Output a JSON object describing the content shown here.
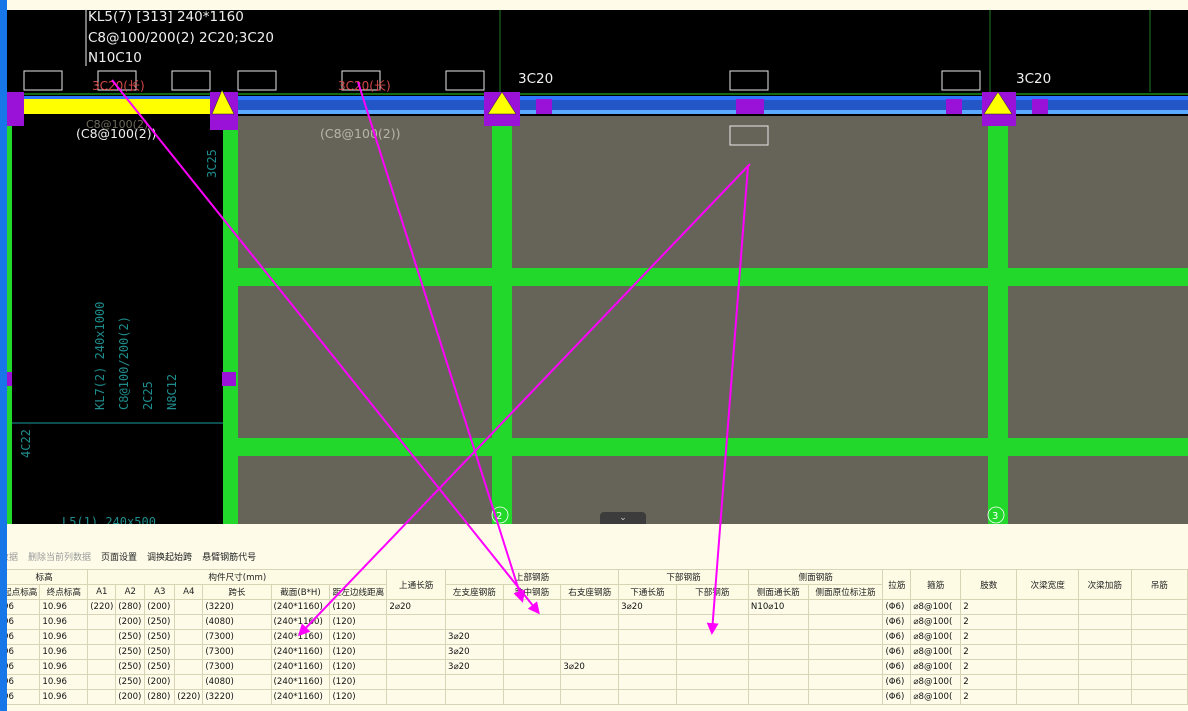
{
  "canvas": {
    "beam_kl5": {
      "line1": "KL5(7) [313] 240*1160",
      "line2": "C8@100/200(2) 2C20;3C20",
      "line3": "N10C10"
    },
    "labels": {
      "top_3c20_a": "3C20",
      "top_3c20_b": "3C20",
      "red_left": "3C20(长)",
      "red_mid": "3C20(长)",
      "stirrup_left": "(C8@100(2))",
      "stirrup_mid": "(C8@100(2))",
      "faded_left": "C8@100(2)",
      "col_3c25": "3C25",
      "kl7_line1": "KL7(2) 240x1000",
      "kl7_line2": "C8@100/200(2)",
      "kl7_line3": "2C25",
      "kl7_line4": "N8C12",
      "left_4c22": "4C22",
      "bottom_left": "L5(1) 240x500",
      "axis_2": "2",
      "axis_3": "3"
    },
    "colors": {
      "background": "#000000",
      "slab": "#666459",
      "green": "#22d82a",
      "yellow": "#ffff00",
      "magenta": "#ff00ff",
      "purple": "#9a11d8",
      "blue": "#2e78ff",
      "red_text": "#e04a4a"
    }
  },
  "toolbar": {
    "items": [
      "数据",
      "删除当前列数据",
      "页面设置",
      "调换起始跨",
      "悬臂钢筋代号"
    ]
  },
  "table": {
    "group_headers": {
      "elevation": "标高",
      "size": "构件尺寸(mm)",
      "top_rebar": "上部钢筋",
      "bottom_rebar": "下部钢筋",
      "side_rebar": "侧面钢筋"
    },
    "columns": {
      "start_elev": "起点标高",
      "end_elev": "终点标高",
      "a1": "A1",
      "a2": "A2",
      "a3": "A3",
      "a4": "A4",
      "span": "跨长",
      "section": "截面(B*H)",
      "offset": "距左边线距离",
      "top_through": "上通长筋",
      "left_support": "左支座钢筋",
      "mid_span": "跨中钢筋",
      "right_support": "右支座钢筋",
      "bottom_through": "下通长筋",
      "bottom_rebar": "下部钢筋",
      "side_through": "侧面通长筋",
      "side_original": "侧面原位标注筋",
      "tie": "拉筋",
      "stirrup": "箍筋",
      "legs": "肢数",
      "sec_beam_width": "次梁宽度",
      "sec_beam_add": "次梁加筋",
      "hanger": "吊筋"
    },
    "rows": [
      {
        "start": "96",
        "end": "10.96",
        "a1": "(220)",
        "a2": "(280)",
        "a3": "(200)",
        "a4": "",
        "span": "(3220)",
        "section": "(240*1160)",
        "offset": "(120)",
        "top": "2⌀20",
        "left": "",
        "mid": "",
        "right": "",
        "bthrough": "3⌀20",
        "bottom": "",
        "side": "N10⌀10",
        "sideo": "",
        "tie": "(Φ6)",
        "stirrup": "⌀8@100(",
        "legs": "2"
      },
      {
        "start": "96",
        "end": "10.96",
        "a1": "",
        "a2": "(200)",
        "a3": "(250)",
        "a4": "",
        "span": "(4080)",
        "section": "(240*1160)",
        "offset": "(120)",
        "top": "",
        "left": "",
        "mid": "",
        "right": "",
        "bthrough": "",
        "bottom": "",
        "side": "",
        "sideo": "",
        "tie": "(Φ6)",
        "stirrup": "⌀8@100(",
        "legs": "2"
      },
      {
        "start": "96",
        "end": "10.96",
        "a1": "",
        "a2": "(250)",
        "a3": "(250)",
        "a4": "",
        "span": "(7300)",
        "section": "(240*1160)",
        "offset": "(120)",
        "top": "",
        "left": "3⌀20",
        "mid": "",
        "right": "",
        "bthrough": "",
        "bottom": "",
        "side": "",
        "sideo": "",
        "tie": "(Φ6)",
        "stirrup": "⌀8@100(",
        "legs": "2"
      },
      {
        "start": "96",
        "end": "10.96",
        "a1": "",
        "a2": "(250)",
        "a3": "(250)",
        "a4": "",
        "span": "(7300)",
        "section": "(240*1160)",
        "offset": "(120)",
        "top": "",
        "left": "3⌀20",
        "mid": "",
        "right": "",
        "bthrough": "",
        "bottom": "",
        "side": "",
        "sideo": "",
        "tie": "(Φ6)",
        "stirrup": "⌀8@100(",
        "legs": "2"
      },
      {
        "start": "96",
        "end": "10.96",
        "a1": "",
        "a2": "(250)",
        "a3": "(250)",
        "a4": "",
        "span": "(7300)",
        "section": "(240*1160)",
        "offset": "(120)",
        "top": "",
        "left": "3⌀20",
        "mid": "",
        "right": "3⌀20",
        "bthrough": "",
        "bottom": "",
        "side": "",
        "sideo": "",
        "tie": "(Φ6)",
        "stirrup": "⌀8@100(",
        "legs": "2"
      },
      {
        "start": "96",
        "end": "10.96",
        "a1": "",
        "a2": "(250)",
        "a3": "(200)",
        "a4": "",
        "span": "(4080)",
        "section": "(240*1160)",
        "offset": "(120)",
        "top": "",
        "left": "",
        "mid": "",
        "right": "",
        "bthrough": "",
        "bottom": "",
        "side": "",
        "sideo": "",
        "tie": "(Φ6)",
        "stirrup": "⌀8@100(",
        "legs": "2"
      },
      {
        "start": "96",
        "end": "10.96",
        "a1": "",
        "a2": "(200)",
        "a3": "(280)",
        "a4": "(220)",
        "span": "(3220)",
        "section": "(240*1160)",
        "offset": "(120)",
        "top": "",
        "left": "",
        "mid": "",
        "right": "",
        "bthrough": "",
        "bottom": "",
        "side": "",
        "sideo": "",
        "tie": "(Φ6)",
        "stirrup": "⌀8@100(",
        "legs": "2"
      }
    ]
  }
}
